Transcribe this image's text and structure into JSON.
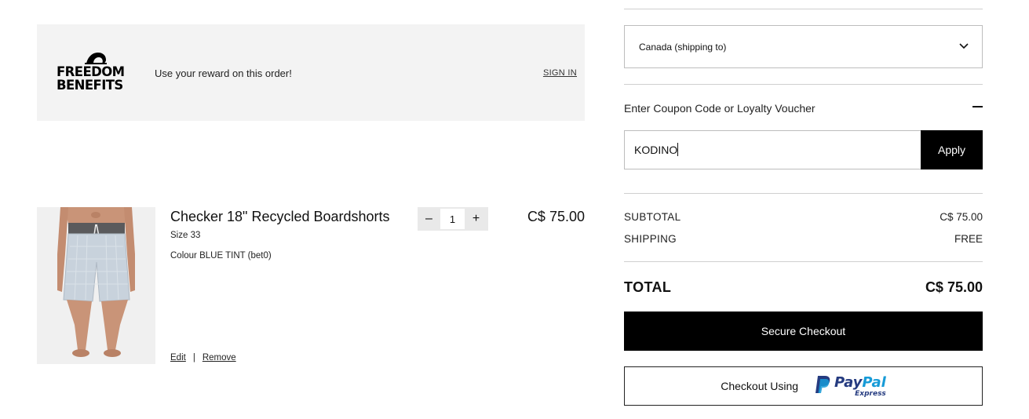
{
  "banner": {
    "logo_line1": "FREEDOM",
    "logo_line2": "BENEFITS",
    "message": "Use your reward on this order!",
    "sign_in": "SIGN IN"
  },
  "product": {
    "title": "Checker 18\" Recycled Boardshorts",
    "size": "Size 33",
    "colour": "Colour BLUE TINT (bet0)",
    "quantity": "1",
    "minus": "–",
    "plus": "+",
    "price": "C$ 75.00",
    "edit": "Edit",
    "separator": "|",
    "remove": "Remove"
  },
  "shipping": {
    "country": "Canada (shipping to)"
  },
  "coupon": {
    "title": "Enter Coupon Code or Loyalty Voucher",
    "value": "KODINO",
    "apply": "Apply"
  },
  "summary": {
    "subtotal_label": "SUBTOTAL",
    "subtotal_value": "C$ 75.00",
    "shipping_label": "SHIPPING",
    "shipping_value": "FREE",
    "total_label": "TOTAL",
    "total_value": "C$ 75.00"
  },
  "checkout": {
    "secure_label": "Secure Checkout",
    "paypal_prefix": "Checkout Using",
    "paypal_pay": "Pay",
    "paypal_pal": "Pal",
    "paypal_express": "Express"
  },
  "icons": {
    "logo": "quiksilver-wave-logo-icon",
    "dropdown": "chevron-down-icon",
    "collapse": "minus-icon",
    "paypal": "paypal-p-icon"
  },
  "colors": {
    "banner_bg": "#f3f3f3",
    "button_bg": "#000000",
    "paypal_dark": "#253b80",
    "paypal_light": "#179bd7"
  }
}
